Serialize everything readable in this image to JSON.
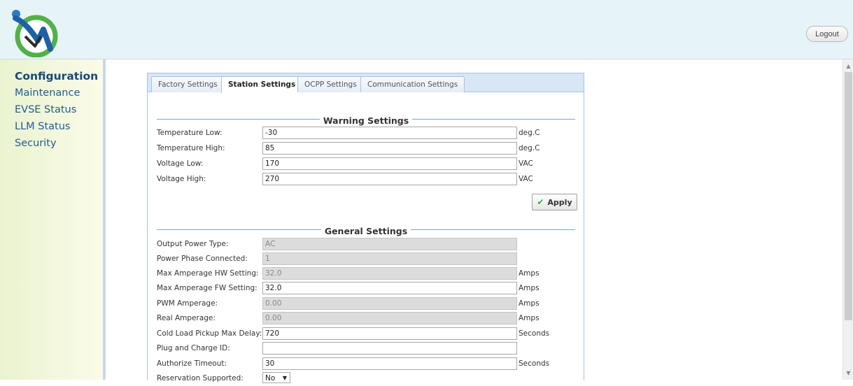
{
  "header": {
    "logout_label": "Logout"
  },
  "sidebar": {
    "items": [
      {
        "label": "Configuration",
        "active": true
      },
      {
        "label": "Maintenance"
      },
      {
        "label": "EVSE Status"
      },
      {
        "label": "LLM Status"
      },
      {
        "label": "Security"
      }
    ]
  },
  "tabs": [
    {
      "label": "Factory Settings"
    },
    {
      "label": "Station Settings",
      "active": true
    },
    {
      "label": "OCPP Settings"
    },
    {
      "label": "Communication Settings"
    }
  ],
  "warning": {
    "title": "Warning Settings",
    "rows": [
      {
        "label": "Temperature Low:",
        "value": "-30",
        "unit": "deg.C"
      },
      {
        "label": "Temperature High:",
        "value": "85",
        "unit": "deg.C"
      },
      {
        "label": "Voltage Low:",
        "value": "170",
        "unit": "VAC"
      },
      {
        "label": "Voltage High:",
        "value": "270",
        "unit": "VAC"
      }
    ],
    "apply_label": "Apply"
  },
  "general": {
    "title": "General Settings",
    "rows": [
      {
        "label": "Output Power Type:",
        "value": "AC",
        "unit": "",
        "readonly": true
      },
      {
        "label": "Power Phase Connected:",
        "value": "1",
        "unit": "",
        "readonly": true
      },
      {
        "label": "Max Amperage HW Setting:",
        "value": "32.0",
        "unit": "Amps",
        "readonly": true
      },
      {
        "label": "Max Amperage FW Setting:",
        "value": "32.0",
        "unit": "Amps"
      },
      {
        "label": "PWM Amperage:",
        "value": "0.00",
        "unit": "Amps",
        "readonly": true
      },
      {
        "label": "Real Amperage:",
        "value": "0.00",
        "unit": "Amps",
        "readonly": true
      },
      {
        "label": "Cold Load Pickup Max Delay:",
        "value": "720",
        "unit": "Seconds"
      },
      {
        "label": "Plug and Charge ID:",
        "value": "",
        "unit": ""
      },
      {
        "label": "Authorize Timeout:",
        "value": "30",
        "unit": "Seconds"
      }
    ],
    "reservation": {
      "label": "Reservation Supported:",
      "value": "No"
    }
  },
  "colors": {
    "header_bg": "#e6f4f7",
    "nav_link": "#1f5b96",
    "tab_border": "#a9c3df",
    "section_rule": "#7da2d4",
    "apply_check": "#3aa64a"
  }
}
